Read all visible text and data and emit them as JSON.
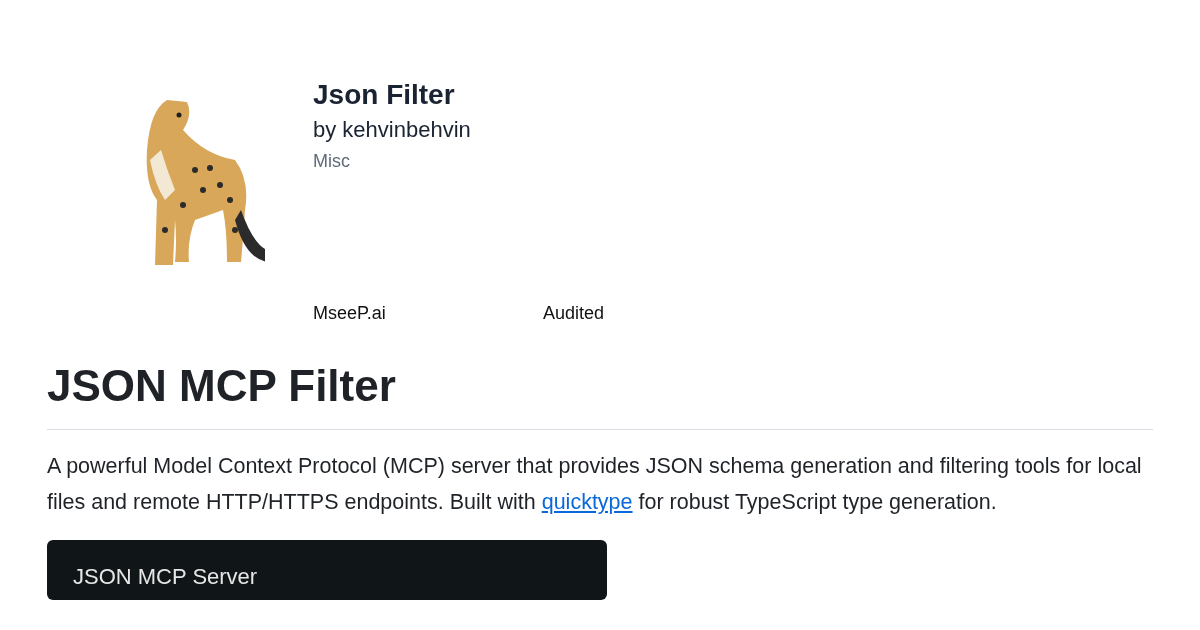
{
  "header": {
    "title": "Json Filter",
    "author": "by kehvinbehvin",
    "category": "Misc",
    "badges": [
      "MseeP.ai",
      "Audited"
    ]
  },
  "readme": {
    "heading": "JSON MCP Filter",
    "intro": {
      "before": "A powerful Model Context Protocol (MCP) server that provides JSON schema generation and filtering tools for local files and remote HTTP/HTTPS endpoints. Built with ",
      "link": "quicktype",
      "after": " for robust TypeScript type generation."
    },
    "code_block": {
      "title": "JSON MCP Server"
    }
  }
}
